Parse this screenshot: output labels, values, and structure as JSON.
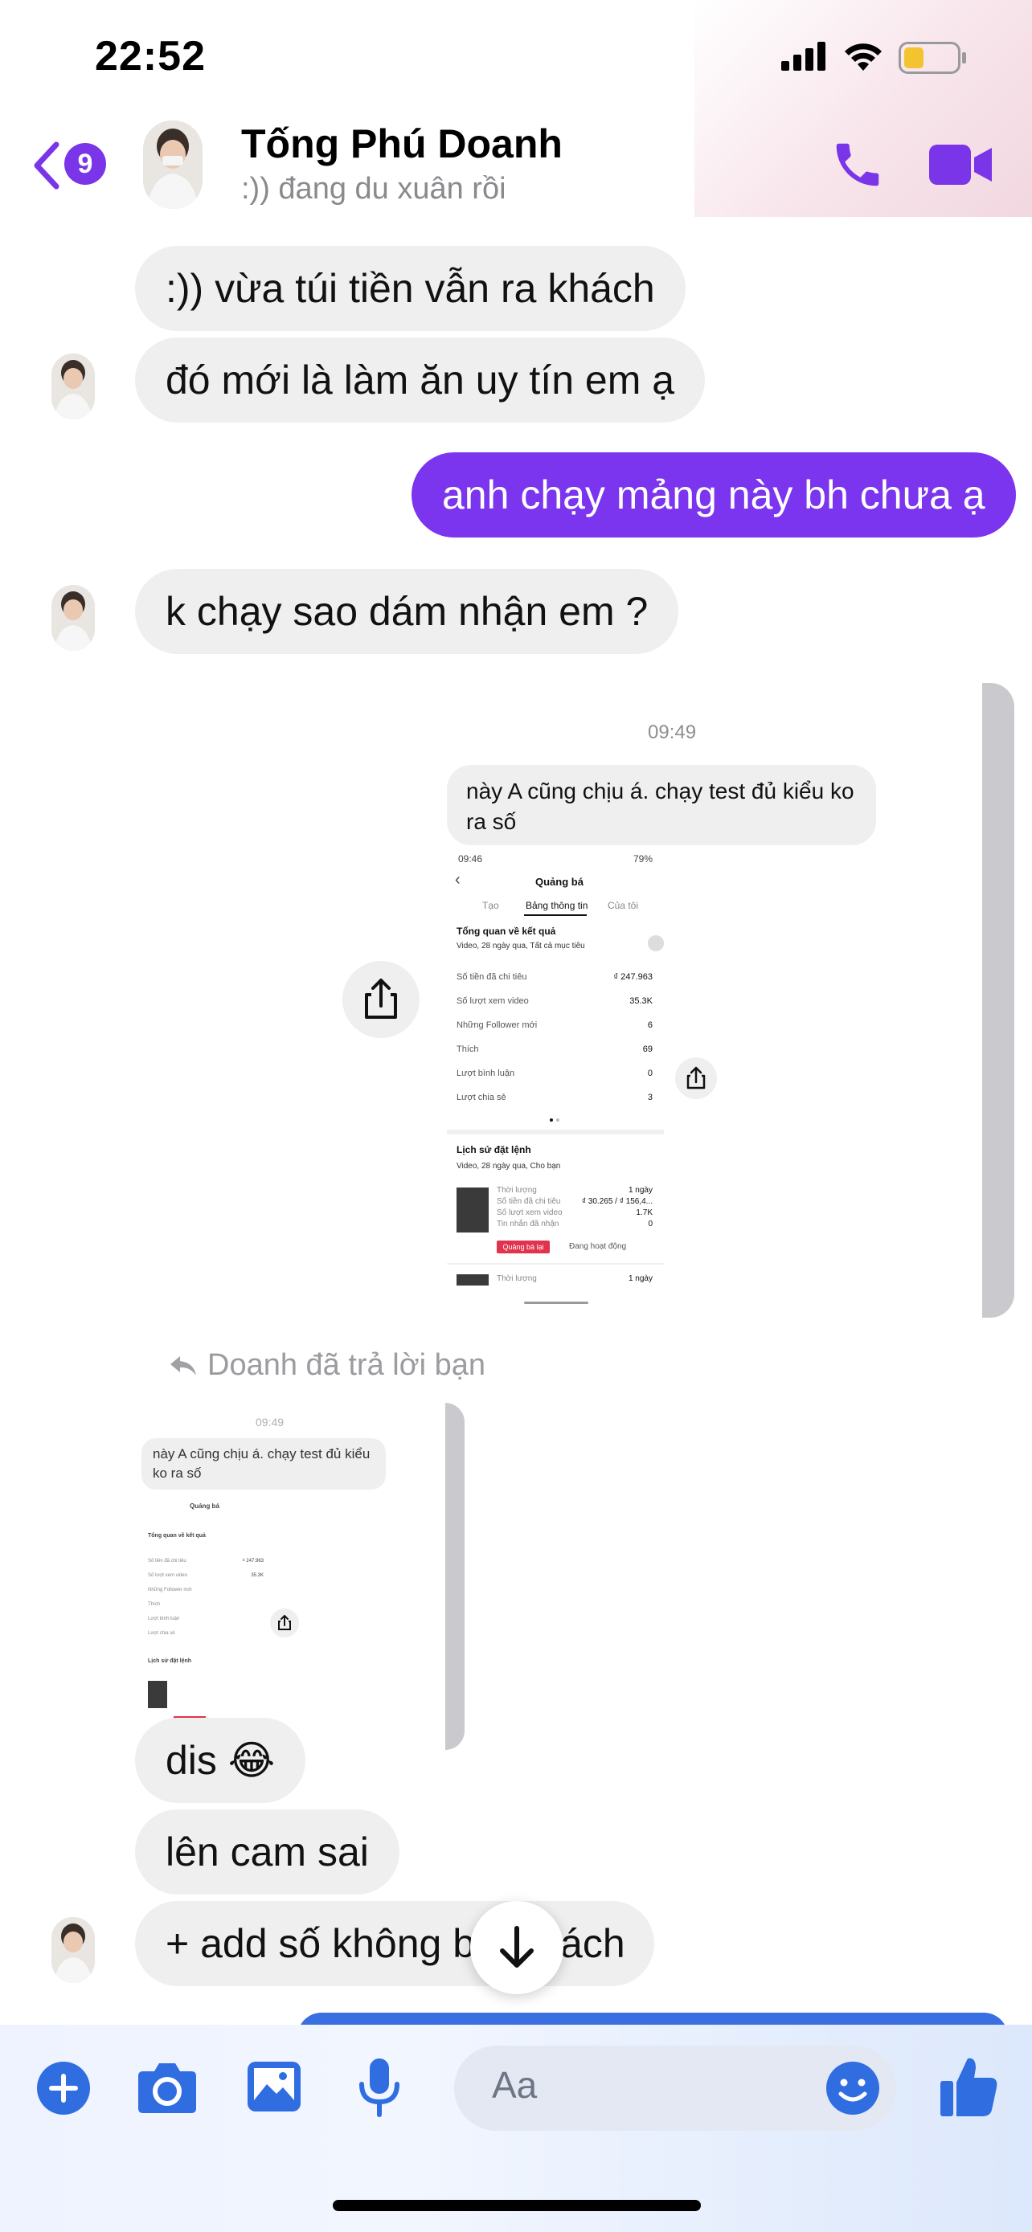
{
  "status_bar": {
    "time": "22:52"
  },
  "header": {
    "back_count": "9",
    "contact_name": "Tống Phú Doanh",
    "contact_status": ":)) đang du xuân rồi"
  },
  "messages": {
    "m1": ":)) vừa túi tiền vẫn ra khách",
    "m2": "đó mới là làm ăn uy tín em ạ",
    "m3": "anh chạy mảng này bh chưa ạ",
    "m4": "k chạy sao dám nhận em ?",
    "m5": "dis 😂",
    "m6": "lên cam sai",
    "m7": "+ add số không b",
    "m7_tail": "ách"
  },
  "forwarded": {
    "timestamp": "09:49",
    "caption": "này A cũng chịu á. chạy test đủ kiểu ko ra số",
    "screenshot": {
      "status": "09:46",
      "battery": "79%",
      "title": "Quảng bá",
      "tabs": [
        "Tạo",
        "Bảng thông tin",
        "Của tôi"
      ],
      "section1": "Tổng quan về kết quả",
      "filter1": "Video, 28 ngày qua, Tất cả mục tiêu",
      "rows": [
        {
          "label": "Số tiền đã chi tiêu",
          "value": "₫ 247.963"
        },
        {
          "label": "Số lượt xem video",
          "value": "35.3K"
        },
        {
          "label": "Những Follower mới",
          "value": "6"
        },
        {
          "label": "Thích",
          "value": "69"
        },
        {
          "label": "Lượt bình luận",
          "value": "0"
        },
        {
          "label": "Lượt chia sẻ",
          "value": "3"
        }
      ],
      "section2": "Lịch sử đặt lệnh",
      "filter2": "Video, 28 ngày qua, Cho bạn",
      "order": [
        {
          "label": "Thời lượng",
          "value": "1 ngày"
        },
        {
          "label": "Số tiền đã chi tiêu",
          "value": "₫ 30.265 / ₫ 156,4..."
        },
        {
          "label": "Số lượt xem video",
          "value": "1.7K"
        },
        {
          "label": "Tin nhắn đã nhận",
          "value": "0"
        }
      ],
      "promote_again": "Quảng bá lại",
      "running": "Đang hoạt động",
      "last_label": "Thời lượng",
      "last_value": "1 ngày"
    }
  },
  "reply_notice": "Doanh đã trả lời bạn",
  "composer": {
    "placeholder": "Aa"
  },
  "colors": {
    "accent": "#7b35ef",
    "composer_blue": "#3a6fe2",
    "bubble_gray": "#efefef"
  },
  "icons": [
    "signal-icon",
    "wifi-icon",
    "battery-icon",
    "back-chevron-icon",
    "phone-icon",
    "video-icon",
    "share-icon",
    "reply-icon",
    "arrow-down-icon",
    "plus-icon",
    "camera-icon",
    "image-icon",
    "mic-icon",
    "emoji-icon",
    "like-icon"
  ]
}
